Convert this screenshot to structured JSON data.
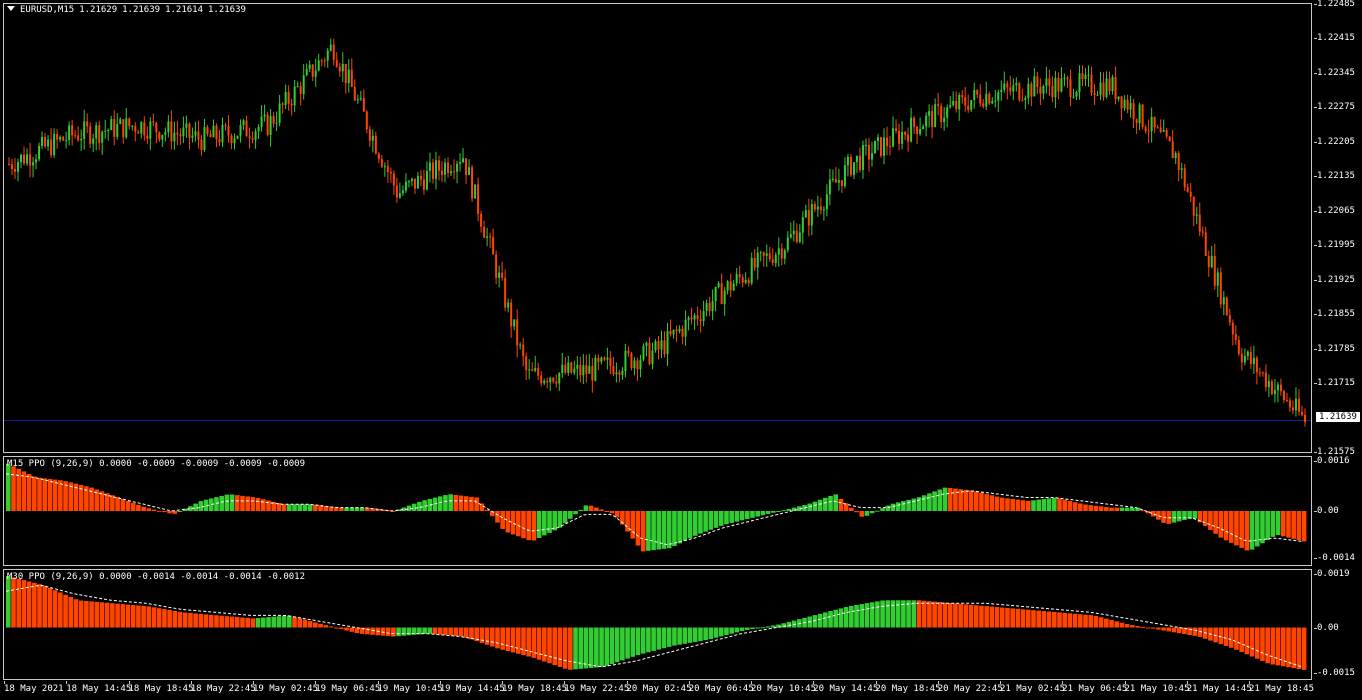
{
  "colors": {
    "bull": "#32cd32",
    "bear": "#ff4500",
    "pos_hist": "#32cd32",
    "neg_hist": "#ff4500",
    "signal": "#ffffff",
    "bid_line": "#1a1a9c",
    "background": "#000000",
    "frame": "#c8c8c8"
  },
  "header": {
    "symbol": "EURUSD,M15",
    "open": "1.21629",
    "high": "1.21639",
    "low": "1.21614",
    "close": "1.21639"
  },
  "price_axis": [
    "1.22485",
    "1.22415",
    "1.22345",
    "1.22275",
    "1.22205",
    "1.22135",
    "1.22065",
    "1.21995",
    "1.21925",
    "1.21855",
    "1.21785",
    "1.21715",
    "1.21575"
  ],
  "current_price": "1.21639",
  "ppo1": {
    "label": "M15 PPO (9,26,9) 0.0000 -0.0009 -0.0009 -0.0009 -0.0009",
    "axis": [
      "0.0016",
      "0.00",
      "-0.0014"
    ]
  },
  "ppo2": {
    "label": "M30 PPO (9,26,9) 0.0000 -0.0014 -0.0014 -0.0014 -0.0012",
    "axis": [
      "0.0019",
      "0.00",
      "-0.0015"
    ]
  },
  "time_axis": [
    "18 May 2021",
    "18 May 14:45",
    "18 May 18:45",
    "18 May 22:45",
    "19 May 02:45",
    "19 May 06:45",
    "19 May 10:45",
    "19 May 14:45",
    "19 May 18:45",
    "19 May 22:45",
    "20 May 02:45",
    "20 May 06:45",
    "20 May 10:45",
    "20 May 14:45",
    "20 May 18:45",
    "20 May 22:45",
    "21 May 02:45",
    "21 May 06:45",
    "21 May 10:45",
    "21 May 14:45",
    "21 May 18:45"
  ],
  "chart_data": [
    {
      "type": "candlestick",
      "title": "EURUSD,M15",
      "ylim": [
        1.21575,
        1.22485
      ],
      "close_path": [
        {
          "t": "18 May 2021",
          "close": 1.2216
        },
        {
          "t": "18 May 14:45",
          "close": 1.2222
        },
        {
          "t": "18 May 18:45",
          "close": 1.2224
        },
        {
          "t": "18 May 22:45",
          "close": 1.2221
        },
        {
          "t": "19 May 02:45",
          "close": 1.2224
        },
        {
          "t": "19 May 06:45",
          "close": 1.224
        },
        {
          "t": "19 May 10:45",
          "close": 1.221
        },
        {
          "t": "19 May 14:45",
          "close": 1.2218
        },
        {
          "t": "19 May 18:45",
          "close": 1.2173
        },
        {
          "t": "19 May 22:45",
          "close": 1.2174
        },
        {
          "t": "20 May 02:45",
          "close": 1.2178
        },
        {
          "t": "20 May 06:45",
          "close": 1.219
        },
        {
          "t": "20 May 10:45",
          "close": 1.22
        },
        {
          "t": "20 May 14:45",
          "close": 1.2216
        },
        {
          "t": "20 May 18:45",
          "close": 1.2224
        },
        {
          "t": "20 May 22:45",
          "close": 1.223
        },
        {
          "t": "21 May 02:45",
          "close": 1.2232
        },
        {
          "t": "21 May 06:45",
          "close": 1.2232
        },
        {
          "t": "21 May 10:45",
          "close": 1.2218
        },
        {
          "t": "21 May 14:45",
          "close": 1.2178
        },
        {
          "t": "21 May 18:45",
          "close": 1.21639
        }
      ],
      "current": 1.21639
    },
    {
      "type": "bar",
      "title": "M15 PPO (9,26,9)",
      "ylim": [
        -0.0016,
        0.0016
      ],
      "histogram": [
        0.0014,
        0.001,
        0.0009,
        0.0007,
        0.0004,
        0.0001,
        -0.0001,
        0.0003,
        0.0005,
        0.0004,
        0.0002,
        0.0002,
        0.0001,
        0.0001,
        0.0,
        0.0003,
        0.0005,
        0.0004,
        -0.0006,
        -0.0009,
        -0.0005,
        0.0002,
        -0.0001,
        -0.0012,
        -0.0011,
        -0.0007,
        -0.0004,
        -0.0002,
        0.0,
        0.0002,
        0.0005,
        -0.0002,
        0.0002,
        0.0004,
        0.0007,
        0.0006,
        0.0004,
        0.0003,
        0.0004,
        0.0002,
        0.0001,
        0.0001,
        -0.0004,
        -0.0002,
        -0.0008,
        -0.0012,
        -0.0007,
        -0.0009
      ],
      "signal": [
        0.0011,
        0.001,
        0.0008,
        0.0006,
        0.0004,
        0.0002,
        0.0,
        0.0001,
        0.0003,
        0.0003,
        0.0002,
        0.0002,
        0.0001,
        0.0001,
        0.0,
        0.0001,
        0.0003,
        0.0003,
        -0.0002,
        -0.0006,
        -0.0005,
        -0.0001,
        -0.0001,
        -0.0008,
        -0.001,
        -0.0008,
        -0.0005,
        -0.0003,
        -0.0001,
        0.0001,
        0.0003,
        0.0001,
        0.0001,
        0.0003,
        0.0005,
        0.0006,
        0.0005,
        0.0004,
        0.0004,
        0.0003,
        0.0002,
        0.0001,
        -0.0002,
        -0.0002,
        -0.0005,
        -0.0009,
        -0.0008,
        -0.0009
      ]
    },
    {
      "type": "bar",
      "title": "M30 PPO (9,26,9)",
      "ylim": [
        -0.0017,
        0.0019
      ],
      "histogram": [
        0.0017,
        0.0014,
        0.0009,
        0.0008,
        0.0007,
        0.0005,
        0.0004,
        0.0003,
        0.0004,
        0.0001,
        -0.0002,
        -0.0003,
        -0.0002,
        -0.0003,
        -0.0007,
        -0.001,
        -0.0014,
        -0.0013,
        -0.0009,
        -0.0006,
        -0.0004,
        -0.0001,
        0.0001,
        0.0004,
        0.0007,
        0.0009,
        0.0009,
        0.0008,
        0.0007,
        0.0006,
        0.0005,
        0.0004,
        0.0001,
        -0.0001,
        -0.0003,
        -0.0007,
        -0.0012,
        -0.0014
      ],
      "signal": [
        0.0012,
        0.0014,
        0.0011,
        0.0009,
        0.0008,
        0.0006,
        0.0005,
        0.0004,
        0.0004,
        0.0002,
        0.0,
        -0.0002,
        -0.0002,
        -0.0003,
        -0.0005,
        -0.0008,
        -0.0011,
        -0.0013,
        -0.0011,
        -0.0008,
        -0.0005,
        -0.0002,
        0.0,
        0.0002,
        0.0005,
        0.0007,
        0.0008,
        0.0008,
        0.0008,
        0.0007,
        0.0006,
        0.0005,
        0.0003,
        0.0001,
        -0.0001,
        -0.0004,
        -0.0009,
        -0.0013
      ]
    }
  ]
}
